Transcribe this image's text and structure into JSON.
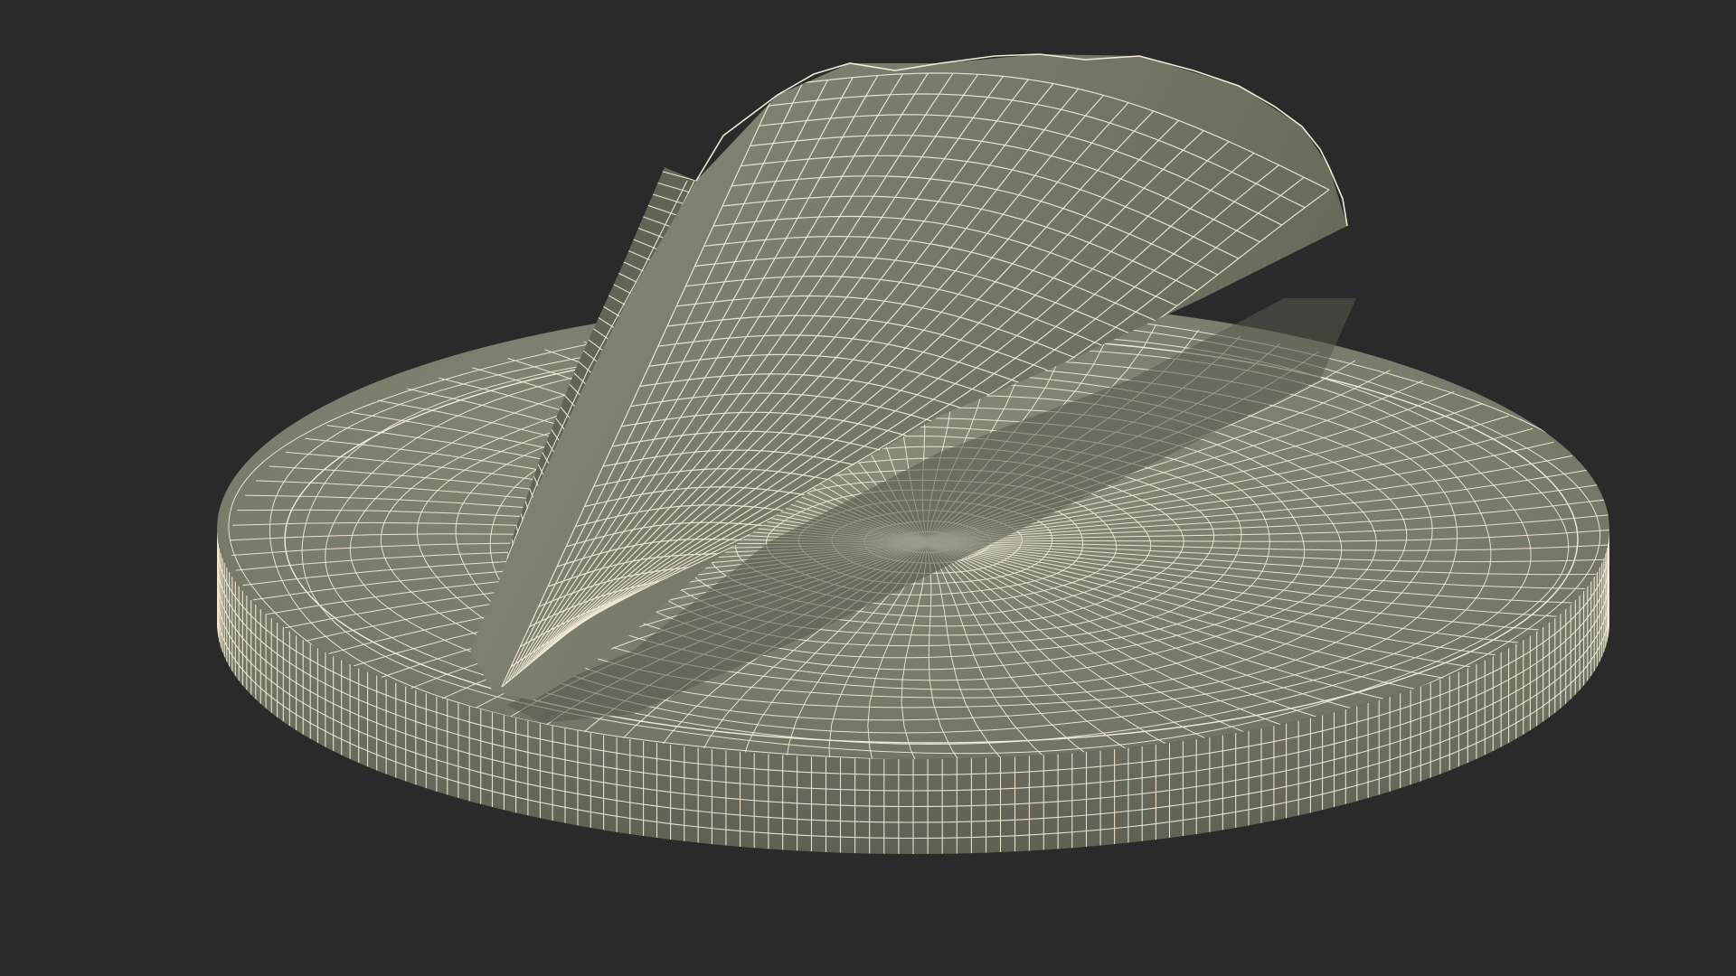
{
  "scene": {
    "background_color": "#2a2a2a",
    "surface_color": "#7b7d6c",
    "surface_shadow_color": "#5c5e50",
    "surface_highlight_color": "#8f917f",
    "wire_color": "#f2ecd6",
    "objects": [
      "base-disc-mesh",
      "folded-cover-mesh"
    ]
  }
}
